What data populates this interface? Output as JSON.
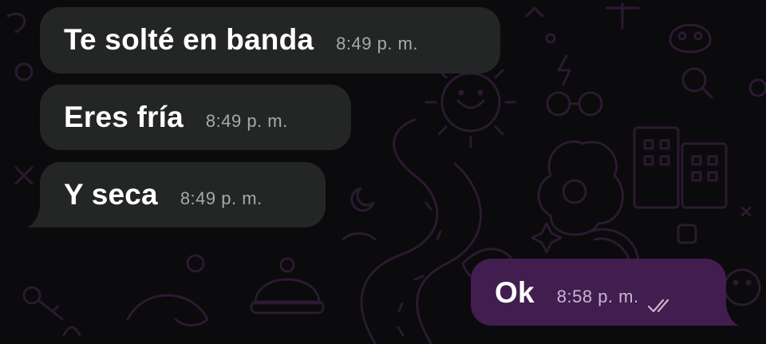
{
  "messages": [
    {
      "direction": "incoming",
      "text": "Te solté en banda",
      "time": "8:49 p. m."
    },
    {
      "direction": "incoming",
      "text": "Eres fría",
      "time": "8:49 p. m."
    },
    {
      "direction": "incoming",
      "text": "Y seca",
      "time": "8:49 p. m."
    },
    {
      "direction": "outgoing",
      "text": "Ok",
      "time": "8:58 p. m.",
      "status": "double-check-icon"
    }
  ],
  "colors": {
    "background": "#0b0a0c",
    "incoming_bubble": "#242626",
    "outgoing_bubble": "#421d4f",
    "wallpaper_doodle": "#2a1a30"
  }
}
